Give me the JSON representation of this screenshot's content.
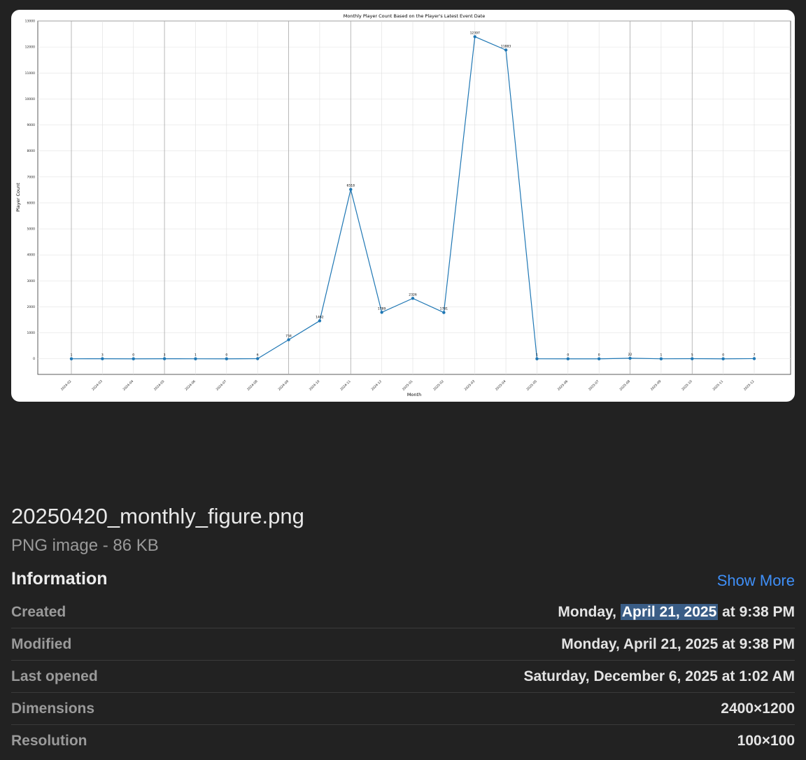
{
  "file": {
    "name": "20250420_monthly_figure.png",
    "kind": "PNG image - 86 KB"
  },
  "info": {
    "heading": "Information",
    "show_more": "Show More",
    "rows": [
      {
        "label": "Created",
        "value_prefix": "Monday, ",
        "value_highlight": "April 21, 2025",
        "value_suffix": " at 9:38 PM"
      },
      {
        "label": "Modified",
        "value": "Monday, April 21, 2025 at 9:38 PM"
      },
      {
        "label": "Last opened",
        "value": "Saturday, December 6, 2025 at 1:02 AM"
      },
      {
        "label": "Dimensions",
        "value": "2400×1200"
      },
      {
        "label": "Resolution",
        "value": "100×100"
      }
    ]
  },
  "chart_data": {
    "type": "line",
    "title": "Monthly Player Count Based on the Player's Latest Event Date",
    "xlabel": "Month",
    "ylabel": "Player Count",
    "ylim": [
      -600,
      13000
    ],
    "yticks": [
      0,
      1000,
      2000,
      3000,
      4000,
      5000,
      6000,
      7000,
      8000,
      9000,
      10000,
      11000,
      12000,
      13000
    ],
    "grid": true,
    "series_color": "#1f77b4",
    "categories": [
      "2024-02",
      "2024-03",
      "2024-04",
      "2024-05",
      "2024-06",
      "2024-07",
      "2024-08",
      "2024-09",
      "2024-10",
      "2024-11",
      "2024-12",
      "2025-01",
      "2025-02",
      "2025-03",
      "2025-04",
      "2025-05",
      "2025-06",
      "2025-07",
      "2025-08",
      "2025-09",
      "2025-10",
      "2025-11",
      "2025-12"
    ],
    "values": [
      1,
      3,
      0,
      3,
      1,
      0,
      6,
      734,
      1462,
      6518,
      1789,
      2326,
      1781,
      12397,
      11883,
      1,
      0,
      0,
      22,
      1,
      5,
      0,
      7
    ]
  }
}
